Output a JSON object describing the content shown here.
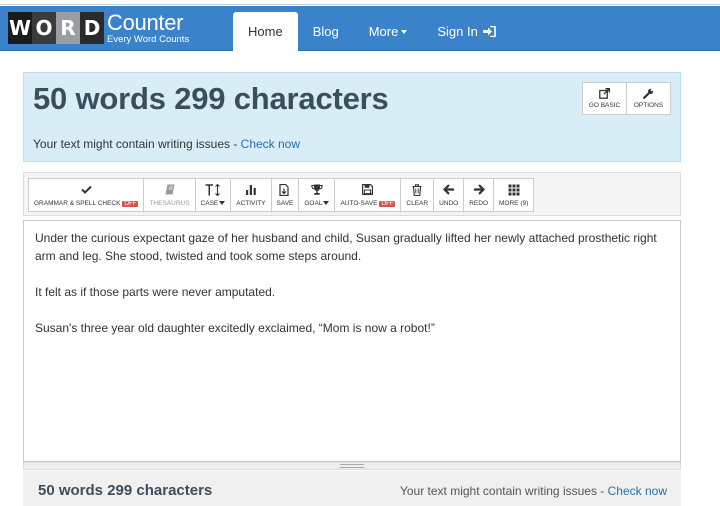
{
  "brand": {
    "letters": [
      "W",
      "O",
      "R",
      "D"
    ],
    "name": "Counter",
    "tagline": "Every Word Counts"
  },
  "nav": {
    "home": "Home",
    "blog": "Blog",
    "more": "More",
    "signin": "Sign In"
  },
  "header": {
    "headline": "50 words 299 characters",
    "writing_prefix": "Your text might contain writing issues - ",
    "check_now": "Check now",
    "go_basic": "GO BASIC",
    "options": "OPTIONS"
  },
  "toolbar": {
    "grammar": "GRAMMAR & SPELL CHECK",
    "grammar_state": "OFF",
    "thesaurus": "THESAURUS",
    "case": "CASE",
    "activity": "ACTIVITY",
    "save": "SAVE",
    "goal": "GOAL",
    "autosave": "AUTO-SAVE",
    "autosave_state": "OFF",
    "clear": "CLEAR",
    "undo": "UNDO",
    "redo": "REDO",
    "more": "MORE (9)"
  },
  "editor": {
    "paragraphs": [
      "Under the curious expectant gaze of her husband and child, Susan gradually lifted her newly attached prosthetic right arm and leg. She stood, twisted and took some steps around.",
      "It felt as if those parts were never amputated.",
      "Susan's three year old daughter excitedly exclaimed, “Mom is now a robot!”"
    ]
  },
  "footer": {
    "counts": "50 words 299 characters",
    "writing_prefix": "Your text might contain writing issues - ",
    "check_now": "Check now"
  },
  "colors": {
    "navbar": "#3a82c9",
    "panel": "#d9edf7",
    "headline": "#3c4e5c",
    "link": "#2a6db0",
    "off_badge": "#d9534f"
  }
}
